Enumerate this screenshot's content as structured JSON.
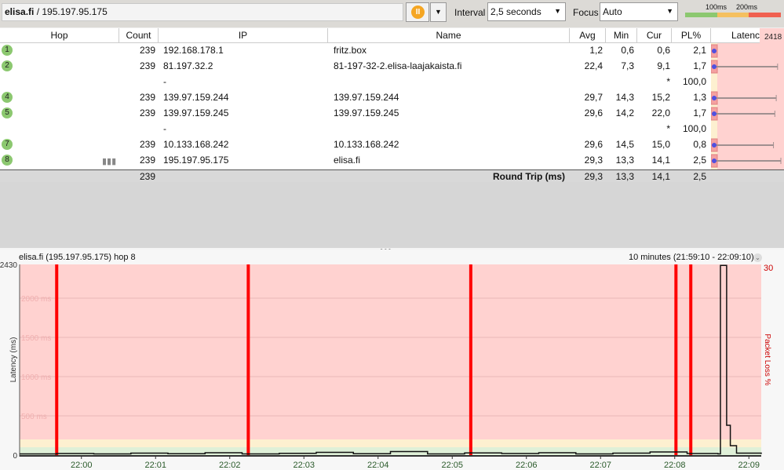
{
  "toolbar": {
    "target_host": "elisa.fi",
    "target_ip": " / 195.197.95.175",
    "pause_icon": "pause-icon",
    "interval_label": "Interval",
    "interval_value": "2,5 seconds",
    "focus_label": "Focus",
    "focus_value": "Auto",
    "scale_100": "100ms",
    "scale_200": "200ms",
    "colors": {
      "good": "#8cc870",
      "warn": "#f5c060",
      "bad": "#f06050"
    }
  },
  "table": {
    "headers": {
      "hop": "Hop",
      "count": "Count",
      "ip": "IP",
      "name": "Name",
      "avg": "Avg",
      "min": "Min",
      "cur": "Cur",
      "pl": "PL%",
      "latency": "Latency",
      "latency_max": "2418"
    },
    "rows": [
      {
        "hop": "1",
        "count": "239",
        "ip": "192.168.178.1",
        "name": "fritz.box",
        "avg": "1,2",
        "min": "0,6",
        "cur": "0,6",
        "pl": "2,1",
        "whisker_ms": 0
      },
      {
        "hop": "2",
        "count": "239",
        "ip": "81.197.32.2",
        "name": "81-197-32-2.elisa-laajakaista.fi",
        "avg": "22,4",
        "min": "7,3",
        "cur": "9,1",
        "pl": "1,7",
        "whisker_ms": 2300
      },
      {
        "hop": "",
        "count": "",
        "ip": "-",
        "name": "",
        "avg": "",
        "min": "",
        "cur": "*",
        "pl": "100,0",
        "whisker_ms": null
      },
      {
        "hop": "4",
        "count": "239",
        "ip": "139.97.159.244",
        "name": "139.97.159.244",
        "avg": "29,7",
        "min": "14,3",
        "cur": "15,2",
        "pl": "1,3",
        "whisker_ms": 2250
      },
      {
        "hop": "5",
        "count": "239",
        "ip": "139.97.159.245",
        "name": "139.97.159.245",
        "avg": "29,6",
        "min": "14,2",
        "cur": "22,0",
        "pl": "1,7",
        "whisker_ms": 2200
      },
      {
        "hop": "",
        "count": "",
        "ip": "-",
        "name": "",
        "avg": "",
        "min": "",
        "cur": "*",
        "pl": "100,0",
        "whisker_ms": null
      },
      {
        "hop": "7",
        "count": "239",
        "ip": "10.133.168.242",
        "name": "10.133.168.242",
        "avg": "29,6",
        "min": "14,5",
        "cur": "15,0",
        "pl": "0,8",
        "whisker_ms": 2150
      },
      {
        "hop": "8",
        "count": "239",
        "ip": "195.197.95.175",
        "name": "elisa.fi",
        "avg": "29,3",
        "min": "13,3",
        "cur": "14,1",
        "pl": "2,5",
        "whisker_ms": 2418,
        "has_graph_icon": true
      }
    ],
    "round_trip": {
      "count": "239",
      "label": "Round Trip (ms)",
      "avg": "29,3",
      "min": "13,3",
      "cur": "14,1",
      "pl": "2,5"
    }
  },
  "chart_data": {
    "type": "line",
    "title": "elisa.fi (195.197.95.175) hop 8",
    "range_label": "10 minutes (21:59:10 - 22:09:10)",
    "ylabel": "Latency (ms)",
    "y2label": "Packet Loss %",
    "ylim": [
      0,
      2430
    ],
    "y2max": "30",
    "ytick_labels": [
      "0",
      "500 ms",
      "1000 ms",
      "1500 ms",
      "2000 ms",
      "2430"
    ],
    "yticks": [
      0,
      500,
      1000,
      1500,
      2000,
      2430
    ],
    "xlim": [
      "21:59:10",
      "22:09:10"
    ],
    "xtick_labels": [
      "22:00",
      "22:01",
      "22:02",
      "22:03",
      "22:04",
      "22:05",
      "22:06",
      "22:07",
      "22:08",
      "22:09"
    ],
    "bands": [
      {
        "from": 0,
        "to": 100,
        "color": "#dff0d8"
      },
      {
        "from": 100,
        "to": 200,
        "color": "#fdf0d0"
      },
      {
        "from": 200,
        "to": 2430,
        "color": "#ffd2d0"
      }
    ],
    "packet_loss_times": [
      "21:59:40",
      "22:02:15",
      "22:05:15",
      "22:08:01",
      "22:08:13"
    ],
    "latency_points": [
      [
        "21:59:10",
        15
      ],
      [
        "21:59:40",
        20
      ],
      [
        "22:00:10",
        15
      ],
      [
        "22:00:40",
        25
      ],
      [
        "22:01:10",
        18
      ],
      [
        "22:01:40",
        30
      ],
      [
        "22:02:10",
        15
      ],
      [
        "22:02:40",
        22
      ],
      [
        "22:03:10",
        35
      ],
      [
        "22:03:40",
        18
      ],
      [
        "22:04:10",
        45
      ],
      [
        "22:04:40",
        15
      ],
      [
        "22:05:10",
        28
      ],
      [
        "22:05:40",
        20
      ],
      [
        "22:06:10",
        30
      ],
      [
        "22:06:40",
        15
      ],
      [
        "22:07:10",
        25
      ],
      [
        "22:07:40",
        40
      ],
      [
        "22:08:10",
        20
      ],
      [
        "22:08:35",
        15
      ],
      [
        "22:08:37",
        2418
      ],
      [
        "22:08:40",
        2418
      ],
      [
        "22:08:42",
        380
      ],
      [
        "22:08:45",
        120
      ],
      [
        "22:08:50",
        25
      ],
      [
        "22:09:10",
        15
      ]
    ],
    "grid": true,
    "colors": {
      "line": "#111111",
      "loss": "#ff0000"
    }
  }
}
